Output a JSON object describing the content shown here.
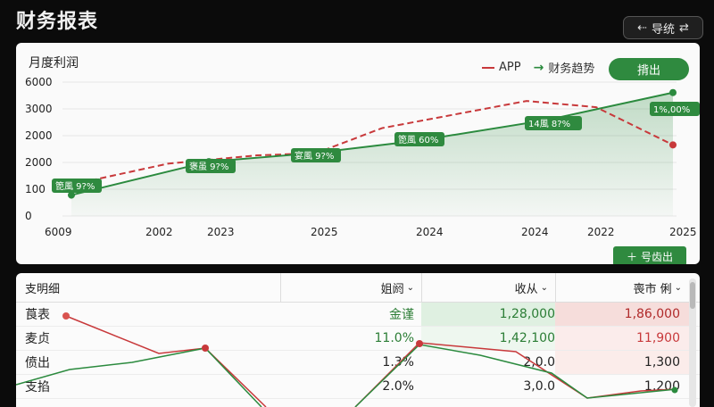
{
  "app": {
    "title": "财务报表"
  },
  "top_button": {
    "label": "导统",
    "icon_left": "arrow-left-icon",
    "icon_right": "swap-icon"
  },
  "panel": {
    "title": "月度利润",
    "legend": [
      {
        "label": "APP",
        "color": "#c8393b"
      },
      {
        "label": "财务趋势",
        "color": "#2b8a3e"
      }
    ],
    "export_label": "揹出",
    "export2_label": "号齿出"
  },
  "chart_data": {
    "type": "line",
    "y_ticks": [
      "6000",
      "3000",
      "2000",
      "2000",
      "100",
      "0"
    ],
    "x_ticks": [
      "6009",
      "2002",
      "2023",
      "2025",
      "2024",
      "2024",
      "2022",
      "2025"
    ],
    "grid": true,
    "series": [
      {
        "name": "财务趋势",
        "color": "#2b8a3e",
        "values": [
          500,
          1300,
          1500,
          1800,
          2300,
          2700,
          2950
        ]
      },
      {
        "name": "APP",
        "color": "#c8393b",
        "values": [
          750,
          1250,
          1450,
          1500,
          2100,
          2750,
          2600,
          1700
        ]
      }
    ],
    "data_labels": [
      "箆風 9?%",
      "褒虽 9?%",
      "宴風 9?%",
      "箆風 60%",
      "14風 8?%",
      "1%,00%"
    ]
  },
  "table": {
    "title": "支明细",
    "headers": [
      "姐阏",
      "收从",
      "喪市 俐"
    ],
    "rows": [
      {
        "name": "莨表",
        "a": "金谨",
        "b": "1,28,000",
        "c": "1,86,000",
        "c_color": "#b02a2a"
      },
      {
        "name": "麦贞",
        "a": "11.0%",
        "b": "1,42,100",
        "c": "11,900",
        "c_color": "#c8393b"
      },
      {
        "name": "偾出",
        "a": "1.3%",
        "b": "2,0.0",
        "c": "1,300",
        "c_color": "#222"
      },
      {
        "name": "支掐",
        "a": "2.0%",
        "b": "3,0.0",
        "c": "1,200",
        "c_color": "#222"
      }
    ]
  },
  "colors": {
    "accent_green": "#2f8a3f",
    "accent_red": "#c8393b",
    "background": "#0b0b0b"
  }
}
